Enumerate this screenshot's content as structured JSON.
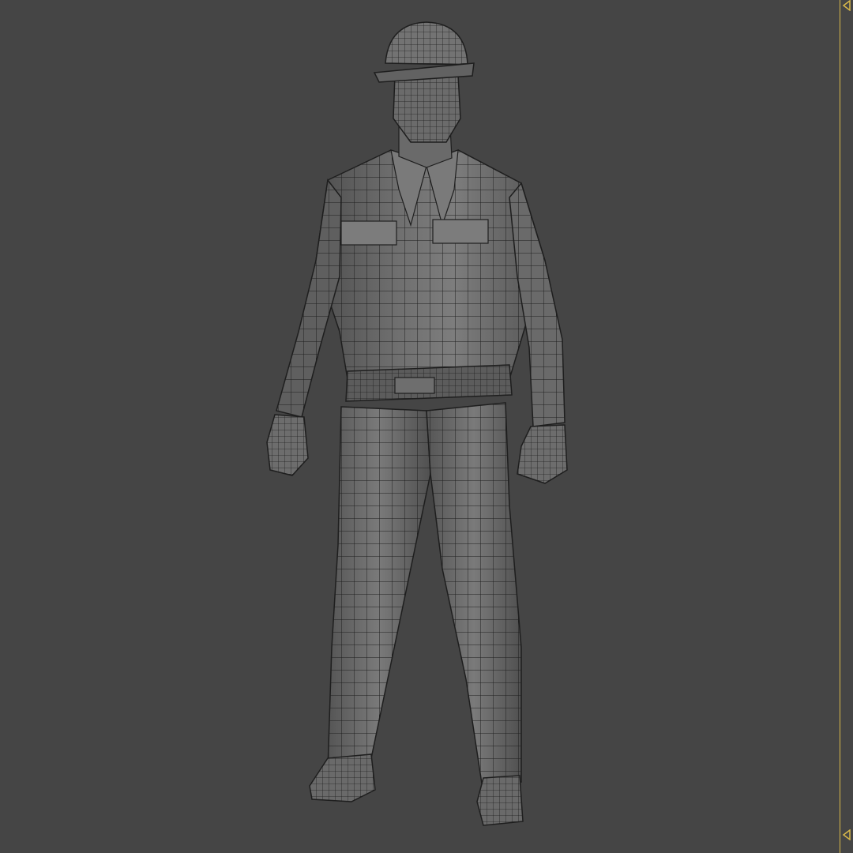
{
  "viewport": {
    "background_color": "#454545",
    "mesh_fill_color": "#6f6f6f",
    "mesh_shade_color": "#4e4e4e",
    "mesh_highlight_color": "#8a8a8a",
    "wire_color": "#1e1e1e",
    "frame_color": "#d8b84a"
  },
  "model": {
    "subject": "worker-figure-wireframe",
    "icon": "hard-hat-icon"
  },
  "timeline": {
    "top_marker_icon": "triangle-left-icon",
    "bottom_marker_icon": "triangle-left-icon"
  }
}
